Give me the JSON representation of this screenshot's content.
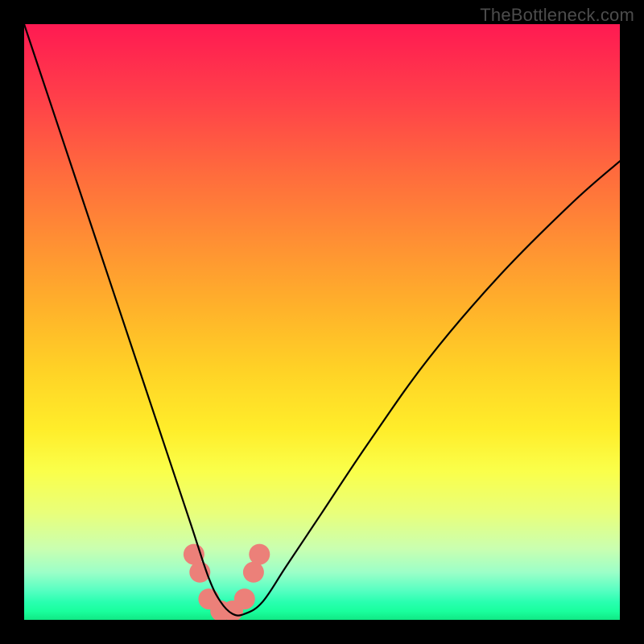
{
  "watermark": "TheBottleneck.com",
  "chart_data": {
    "type": "line",
    "title": "",
    "xlabel": "",
    "ylabel": "",
    "xlim": [
      0,
      100
    ],
    "ylim": [
      0,
      100
    ],
    "series": [
      {
        "name": "bottleneck-curve",
        "x": [
          0,
          4,
          8,
          12,
          16,
          20,
          24,
          28,
          31,
          33,
          35,
          37,
          40,
          44,
          50,
          58,
          68,
          80,
          92,
          100
        ],
        "values": [
          100,
          88,
          76,
          64,
          52,
          40,
          28,
          16,
          7,
          3,
          1,
          1,
          3,
          9,
          18,
          30,
          44,
          58,
          70,
          77
        ]
      }
    ],
    "markers": {
      "name": "highlight-dots",
      "x": [
        28.5,
        29.5,
        31,
        33,
        35,
        37,
        38.5,
        39.5
      ],
      "values": [
        11,
        8,
        3.5,
        1.5,
        1.5,
        3.5,
        8,
        11
      ],
      "color": "#ec8079",
      "radius_px": 13
    },
    "background_gradient": {
      "top": "#ff1a52",
      "mid": "#ffe02a",
      "bottom": "#11e884"
    }
  }
}
